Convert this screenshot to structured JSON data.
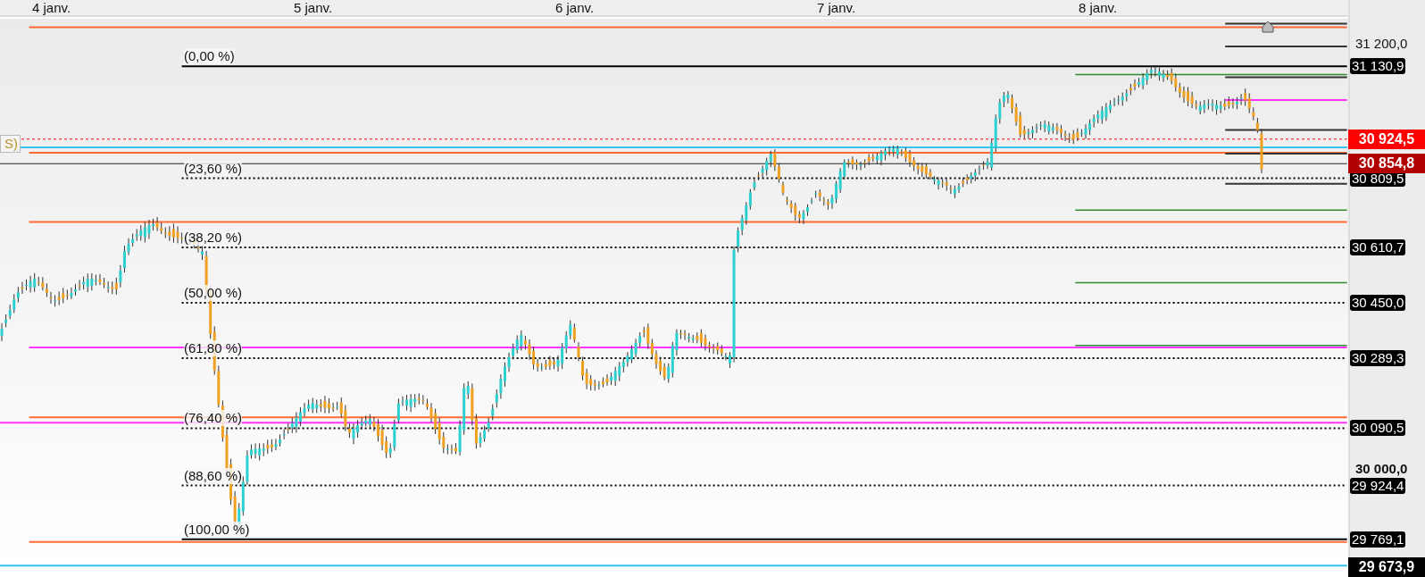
{
  "date_axis": [
    {
      "label": "4 janv."
    },
    {
      "label": "5 janv."
    },
    {
      "label": "6 janv."
    },
    {
      "label": "7 janv."
    },
    {
      "label": "8 janv."
    }
  ],
  "clipped_label": "S)",
  "fib_levels": [
    {
      "label": "(0,00 %)",
      "price": "31 130,9"
    },
    {
      "label": "(23,60 %)",
      "price": "30 809,5"
    },
    {
      "label": "(38,20 %)",
      "price": "30 610,7"
    },
    {
      "label": "(50,00 %)",
      "price": "30 450,0"
    },
    {
      "label": "(61,80 %)",
      "price": "30 289,3"
    },
    {
      "label": "(76,40 %)",
      "price": "30 090,5"
    },
    {
      "label": "(88,60 %)",
      "price": "29 924,4"
    },
    {
      "label": "(100,00 %)",
      "price": "29 769,1"
    }
  ],
  "price_axis": [
    {
      "label": "31 200,0"
    },
    {
      "label": "30 000,0"
    }
  ],
  "price_tags": [
    {
      "label": "30 924,5",
      "color": "#ff0000"
    },
    {
      "label": "30 854,8",
      "color": "#b00000"
    },
    {
      "label": "29 673,9",
      "color": "#000000"
    }
  ]
}
